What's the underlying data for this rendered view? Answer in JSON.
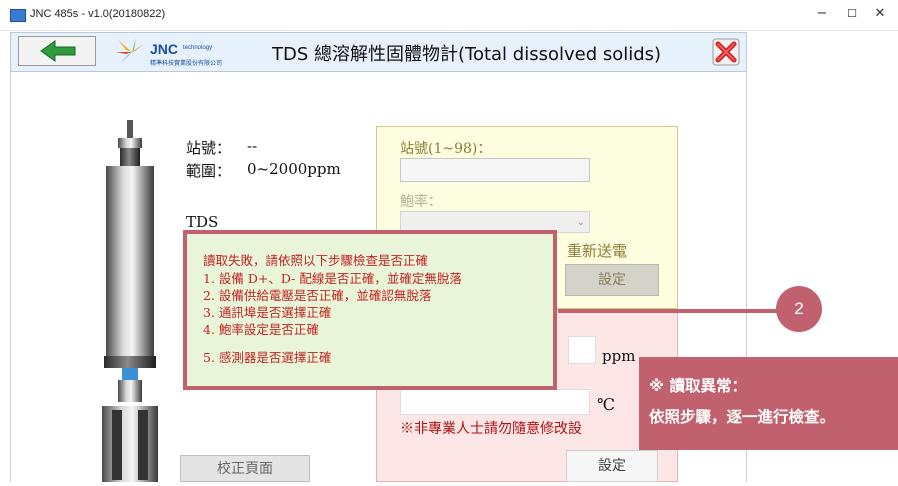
{
  "window": {
    "title": "JNC 485s - v1.0(20180822)",
    "minimize_glyph": "−",
    "maximize_glyph": "☐",
    "close_glyph": "✕"
  },
  "header": {
    "back_icon": "back-arrow-icon",
    "logo_text": "JNC",
    "logo_small": "technology",
    "logo_subtitle": "精準科技實業股份有限公司",
    "title": "TDS 總溶解性固體物計(Total dissolved solids)",
    "close_icon": "red-x-close-icon"
  },
  "sensor_info": {
    "station_label": "站號：",
    "station_value": "--",
    "range_label": "範圍：",
    "range_value": "0~2000ppm",
    "tds_label": "TDS"
  },
  "settings": {
    "station_field_label": "站號(1~98)：",
    "station_field_value": "",
    "baud_label": "鮑率：",
    "baud_value": "",
    "repower_text": "重新送電",
    "set_button": "設定"
  },
  "calibration": {
    "ppm_unit": "ppm",
    "temp_unit": "℃",
    "warning": "※非專業人士請勿隨意修改設",
    "set_button": "設定",
    "calib_page_button": "校正頁面"
  },
  "error_dialog": {
    "title": "讀取失敗，請依照以下步驟檢查是否正確",
    "steps": [
      "1.  設備 D+、D- 配線是否正確，並確定無脫落",
      "2.  設備供給電壓是否正確，並確認無脫落",
      "3.  通訊埠是否選擇正確",
      "4.  鮑率設定是否正確",
      "5.  感測器是否選擇正確"
    ]
  },
  "callout": {
    "number": "2",
    "note_line1": "※ 讀取異常：",
    "note_line2": "依照步驟，逐一進行檢查。"
  },
  "colors": {
    "accent_red": "#c2616e",
    "error_text": "#c42424",
    "dialog_bg": "#e8f5d8",
    "yellow_panel": "#fdfde0",
    "pink_panel": "#fde6e6"
  }
}
